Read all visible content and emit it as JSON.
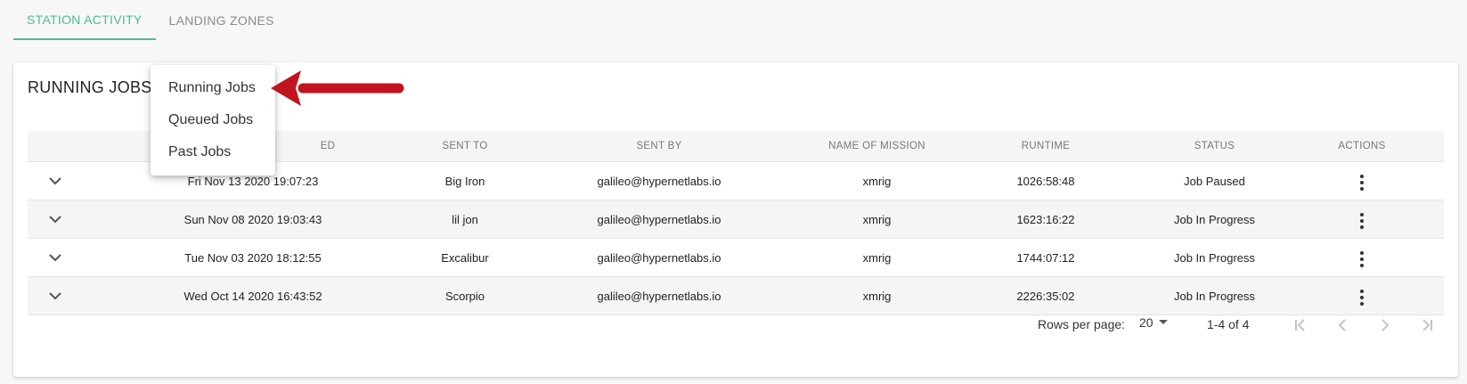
{
  "tabs": [
    {
      "label": "STATION ACTIVITY",
      "active": true
    },
    {
      "label": "LANDING ZONES",
      "active": false
    }
  ],
  "card": {
    "title": "RUNNING JOBS"
  },
  "menu": {
    "items": [
      "Running Jobs",
      "Queued Jobs",
      "Past Jobs"
    ]
  },
  "table": {
    "headers": [
      "",
      "ED",
      "SENT TO",
      "SENT BY",
      "NAME OF MISSION",
      "RUNTIME",
      "STATUS",
      "ACTIONS"
    ],
    "rows": [
      [
        "Fri Nov 13 2020 19:07:23",
        "Big Iron",
        "galileo@hypernetlabs.io",
        "xmrig",
        "1026:58:48",
        "Job Paused"
      ],
      [
        "Sun Nov 08 2020 19:03:43",
        "lil jon",
        "galileo@hypernetlabs.io",
        "xmrig",
        "1623:16:22",
        "Job In Progress"
      ],
      [
        "Tue Nov 03 2020 18:12:55",
        "Excalibur",
        "galileo@hypernetlabs.io",
        "xmrig",
        "1744:07:12",
        "Job In Progress"
      ],
      [
        "Wed Oct 14 2020 16:43:52",
        "Scorpio",
        "galileo@hypernetlabs.io",
        "xmrig",
        "2226:35:02",
        "Job In Progress"
      ]
    ]
  },
  "pagination": {
    "rows_per_page_label": "Rows per page:",
    "rows_per_page_value": "20",
    "range": "1-4 of 4"
  },
  "colors": {
    "accent": "#4dbb95",
    "arrow": "#c1141f"
  },
  "icons": [
    "chevron-down-icon",
    "more-vert-icon",
    "first-page-icon",
    "prev-page-icon",
    "next-page-icon",
    "last-page-icon",
    "dropdown-arrow-icon",
    "annotation-arrow-icon"
  ]
}
